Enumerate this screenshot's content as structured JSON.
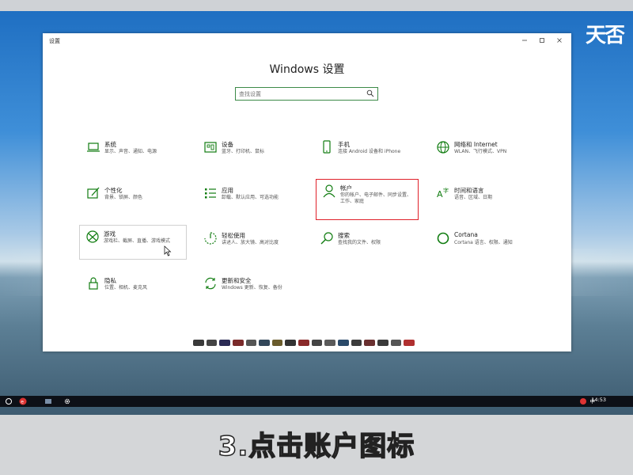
{
  "window": {
    "title": "设置",
    "heading": "Windows 设置"
  },
  "search": {
    "placeholder": "查找设置"
  },
  "tiles": [
    {
      "name": "系统",
      "desc": "显示、声音、通知、电源"
    },
    {
      "name": "设备",
      "desc": "蓝牙、打印机、鼠标"
    },
    {
      "name": "手机",
      "desc": "连接 Android 设备和 iPhone"
    },
    {
      "name": "网络和 Internet",
      "desc": "WLAN、飞行模式、VPN"
    },
    {
      "name": "个性化",
      "desc": "背景、锁屏、颜色"
    },
    {
      "name": "应用",
      "desc": "卸载、默认应用、可选功能"
    },
    {
      "name": "帐户",
      "desc": "你的帐户、电子邮件、同步设置、工作、家庭"
    },
    {
      "name": "时间和语言",
      "desc": "语音、区域、日期"
    },
    {
      "name": "游戏",
      "desc": "游戏栏、截屏、直播、游戏模式"
    },
    {
      "name": "轻松使用",
      "desc": "讲述人、放大镜、高对比度"
    },
    {
      "name": "搜索",
      "desc": "查找我的文件、权限"
    },
    {
      "name": "Cortana",
      "desc": "Cortana 语言、权限、通知"
    },
    {
      "name": "隐私",
      "desc": "位置、相机、麦克风"
    },
    {
      "name": "更新和安全",
      "desc": "Windows 更新、恢复、备份"
    }
  ],
  "icons": [
    "laptop-icon",
    "keyboard-icon",
    "phone-icon",
    "globe-icon",
    "palette-icon",
    "apps-list-icon",
    "person-icon",
    "time-language-icon",
    "xbox-icon",
    "ease-of-access-icon",
    "search-icon",
    "cortana-icon",
    "lock-icon",
    "sync-icon"
  ],
  "taskbar": {
    "time": "14:53",
    "ime": "中"
  },
  "wallpaper_mark": "天否",
  "caption": "3.点击账户图标",
  "colors": {
    "accent": "#107c10",
    "highlight": "#e0202a"
  }
}
